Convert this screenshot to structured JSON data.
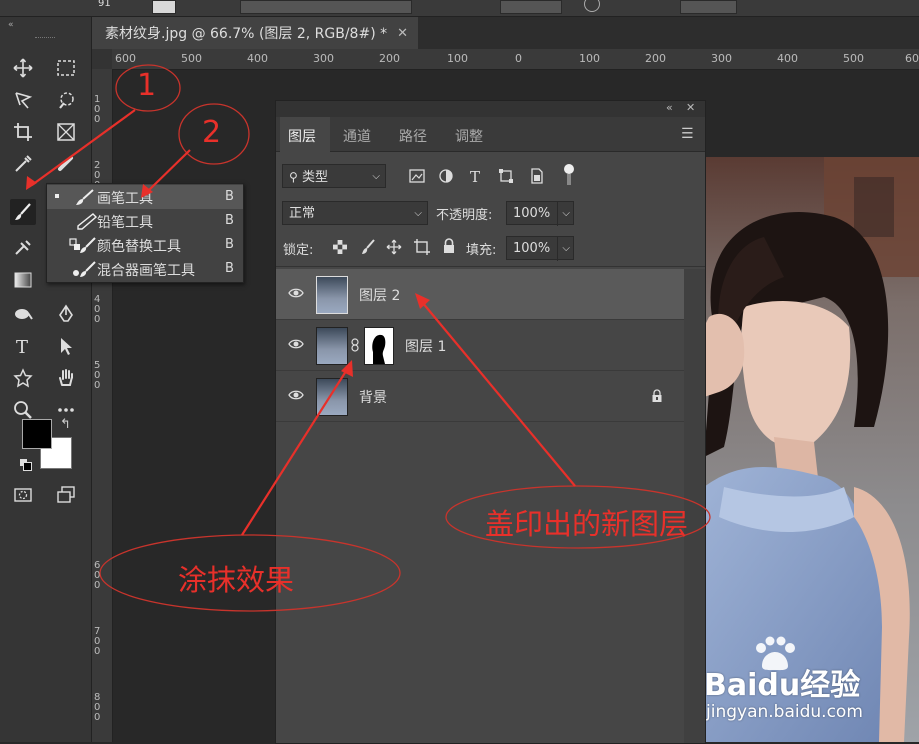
{
  "option_bar": {
    "value": "91"
  },
  "document": {
    "tab_title": "素材纹身.jpg @ 66.7% (图层 2, RGB/8#) *",
    "close_symbol": "✕"
  },
  "ruler": {
    "h_labels": [
      "600",
      "500",
      "400",
      "300",
      "200",
      "100",
      "0",
      "100",
      "200",
      "300",
      "400",
      "500",
      "600"
    ],
    "v_labels": [
      "100",
      "200",
      "300",
      "400",
      "500",
      "600",
      "700",
      "800"
    ]
  },
  "tool_flyout": {
    "items": [
      {
        "label": "画笔工具",
        "key": "B",
        "icon": "brush-icon",
        "current": true
      },
      {
        "label": "铅笔工具",
        "key": "B",
        "icon": "pencil-icon",
        "current": false
      },
      {
        "label": "颜色替换工具",
        "key": "B",
        "icon": "color-replace-icon",
        "current": false
      },
      {
        "label": "混合器画笔工具",
        "key": "B",
        "icon": "mixer-brush-icon",
        "current": false
      }
    ]
  },
  "layers_panel": {
    "collapse_symbol": "«",
    "close_symbol": "✕",
    "tabs": [
      "图层",
      "通道",
      "路径",
      "调整"
    ],
    "active_tab": "图层",
    "filter": {
      "kind_label": "类型"
    },
    "blend_mode": "正常",
    "opacity_label": "不透明度:",
    "opacity_value": "100%",
    "lock_label": "锁定:",
    "fill_label": "填充:",
    "fill_value": "100%",
    "layers": [
      {
        "name": "图层 2",
        "selected": true,
        "has_mask": false,
        "locked": false
      },
      {
        "name": "图层 1",
        "selected": false,
        "has_mask": true,
        "locked": false
      },
      {
        "name": "背景",
        "selected": false,
        "has_mask": false,
        "locked": true
      }
    ]
  },
  "annotations": {
    "num1": "1",
    "num2": "2",
    "smear_label": "涂抹效果",
    "new_layer_label": "盖印出的新图层",
    "color": "#e8302a"
  },
  "watermark": {
    "brand": "Baidu经验",
    "url": "jingyan.baidu.com"
  },
  "colors": {
    "foreground": "#000000",
    "background": "#ffffff",
    "panel": "#464646",
    "accent_red": "#e8302a"
  }
}
